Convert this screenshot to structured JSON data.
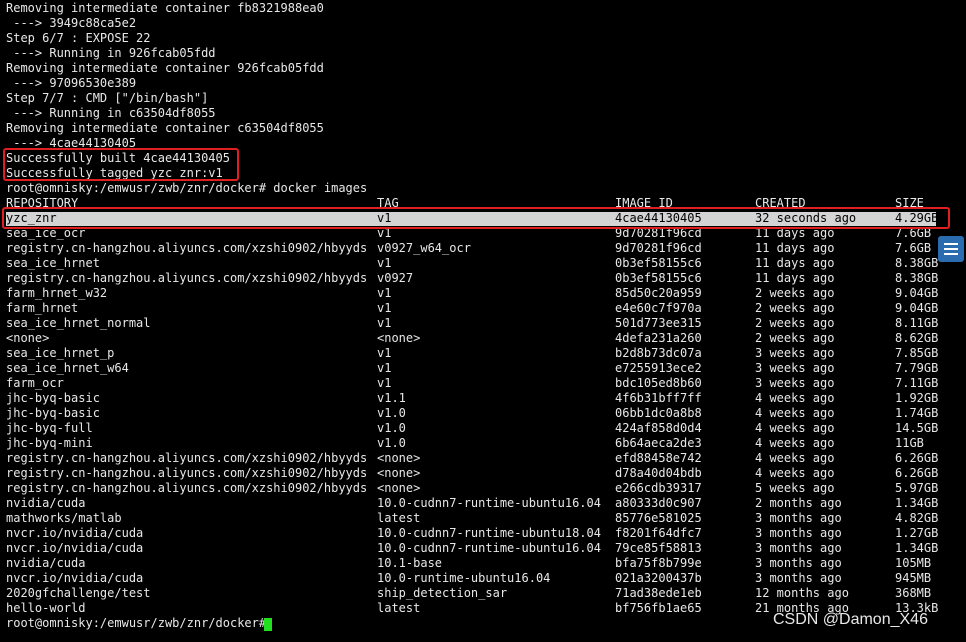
{
  "build_log": [
    "Removing intermediate container fb8321988ea0",
    " ---> 3949c88ca5e2",
    "Step 6/7 : EXPOSE 22",
    " ---> Running in 926fcab05fdd",
    "Removing intermediate container 926fcab05fdd",
    " ---> 97096530e389",
    "Step 7/7 : CMD [\"/bin/bash\"]",
    " ---> Running in c63504df8055",
    "Removing intermediate container c63504df8055",
    " ---> 4cae44130405",
    "Successfully built 4cae44130405",
    "Successfully tagged yzc_znr:v1"
  ],
  "prompt1": "root@omnisky:/emwusr/zwb/znr/docker# docker images",
  "headers": [
    "REPOSITORY",
    "TAG",
    "IMAGE ID",
    "CREATED",
    "SIZE"
  ],
  "rows": [
    [
      "yzc_znr",
      "v1",
      "4cae44130405",
      "32 seconds ago",
      "4.29GB"
    ],
    [
      "sea_ice_ocr",
      "v1",
      "9d70281f96cd",
      "11 days ago",
      "7.6GB"
    ],
    [
      "registry.cn-hangzhou.aliyuncs.com/xzshi0902/hbyyds",
      "v0927_w64_ocr",
      "9d70281f96cd",
      "11 days ago",
      "7.6GB"
    ],
    [
      "sea_ice_hrnet",
      "v1",
      "0b3ef58155c6",
      "11 days ago",
      "8.38GB"
    ],
    [
      "registry.cn-hangzhou.aliyuncs.com/xzshi0902/hbyyds",
      "v0927",
      "0b3ef58155c6",
      "11 days ago",
      "8.38GB"
    ],
    [
      "farm_hrnet_w32",
      "v1",
      "85d50c20a959",
      "2 weeks ago",
      "9.04GB"
    ],
    [
      "farm_hrnet",
      "v1",
      "e4e60c7f970a",
      "2 weeks ago",
      "9.04GB"
    ],
    [
      "sea_ice_hrnet_normal",
      "v1",
      "501d773ee315",
      "2 weeks ago",
      "8.11GB"
    ],
    [
      "<none>",
      "<none>",
      "4defa231a260",
      "2 weeks ago",
      "8.62GB"
    ],
    [
      "sea_ice_hrnet_p",
      "v1",
      "b2d8b73dc07a",
      "3 weeks ago",
      "7.85GB"
    ],
    [
      "sea_ice_hrnet_w64",
      "v1",
      "e7255913ece2",
      "3 weeks ago",
      "7.79GB"
    ],
    [
      "farm_ocr",
      "v1",
      "bdc105ed8b60",
      "3 weeks ago",
      "7.11GB"
    ],
    [
      "jhc-byq-basic",
      "v1.1",
      "4f6b31bff7ff",
      "4 weeks ago",
      "1.92GB"
    ],
    [
      "jhc-byq-basic",
      "v1.0",
      "06bb1dc0a8b8",
      "4 weeks ago",
      "1.74GB"
    ],
    [
      "jhc-byq-full",
      "v1.0",
      "424af858d0d4",
      "4 weeks ago",
      "14.5GB"
    ],
    [
      "jhc-byq-mini",
      "v1.0",
      "6b64aeca2de3",
      "4 weeks ago",
      "11GB"
    ],
    [
      "registry.cn-hangzhou.aliyuncs.com/xzshi0902/hbyyds",
      "<none>",
      "efd88458e742",
      "4 weeks ago",
      "6.26GB"
    ],
    [
      "registry.cn-hangzhou.aliyuncs.com/xzshi0902/hbyyds",
      "<none>",
      "d78a40d04bdb",
      "4 weeks ago",
      "6.26GB"
    ],
    [
      "registry.cn-hangzhou.aliyuncs.com/xzshi0902/hbyyds",
      "<none>",
      "e266cdb39317",
      "5 weeks ago",
      "5.97GB"
    ],
    [
      "nvidia/cuda",
      "10.0-cudnn7-runtime-ubuntu16.04",
      "a80333d0c907",
      "2 months ago",
      "1.34GB"
    ],
    [
      "mathworks/matlab",
      "latest",
      "85776e581025",
      "3 months ago",
      "4.82GB"
    ],
    [
      "nvcr.io/nvidia/cuda",
      "10.0-cudnn7-runtime-ubuntu18.04",
      "f8201f64dfc7",
      "3 months ago",
      "1.27GB"
    ],
    [
      "nvcr.io/nvidia/cuda",
      "10.0-cudnn7-runtime-ubuntu16.04",
      "79ce85f58813",
      "3 months ago",
      "1.34GB"
    ],
    [
      "nvidia/cuda",
      "10.1-base",
      "bfa75f8b799e",
      "3 months ago",
      "105MB"
    ],
    [
      "nvcr.io/nvidia/cuda",
      "10.0-runtime-ubuntu16.04",
      "021a3200437b",
      "3 months ago",
      "945MB"
    ],
    [
      "2020gfchallenge/test",
      "ship_detection_sar",
      "71ad38ede1eb",
      "12 months ago",
      "368MB"
    ],
    [
      "hello-world",
      "latest",
      "bf756fb1ae65",
      "21 months ago",
      "13.3kB"
    ]
  ],
  "prompt2": "root@omnisky:/emwusr/zwb/znr/docker# ",
  "watermark": "CSDN @Damon_X46",
  "colors": {
    "background": "#000000",
    "text": "#e8e8e8",
    "highlight": "#e02020",
    "cursor": "#20e020"
  }
}
